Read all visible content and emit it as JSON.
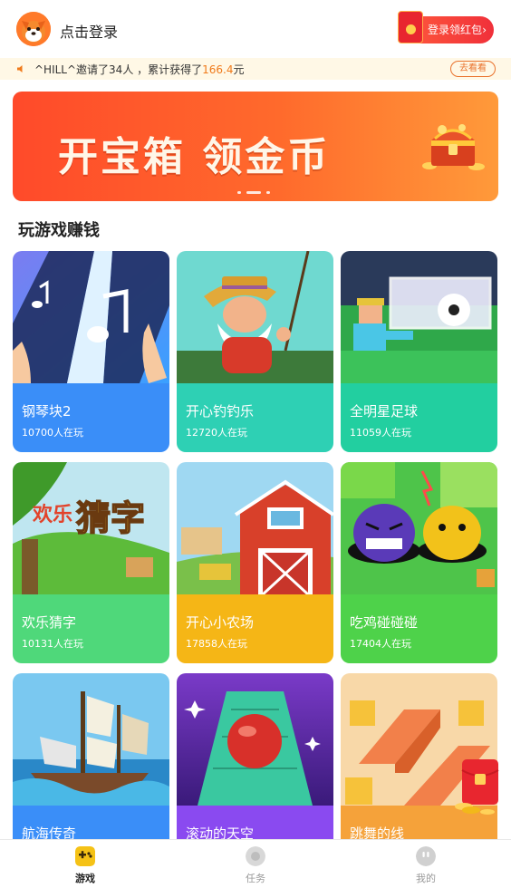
{
  "header": {
    "login_text": "点击登录",
    "redpack_label": "登录领红包",
    "redpack_chevron": "›"
  },
  "invite": {
    "text_prefix": "^HILL^邀请了34人 ，累计获得了",
    "amount": "166.4",
    "unit": "元",
    "button_label": "去看看"
  },
  "banner": {
    "text": "开宝箱 领金币",
    "slide_count": 3,
    "active_slide": 2
  },
  "section": {
    "title": "玩游戏赚钱"
  },
  "games": [
    {
      "name": "钢琴块2",
      "plays": "10700人在玩",
      "icon": "piano-tiles-art"
    },
    {
      "name": "开心钓钓乐",
      "plays": "12720人在玩",
      "icon": "fishing-art"
    },
    {
      "name": "全明星足球",
      "plays": "11059人在玩",
      "icon": "soccer-art"
    },
    {
      "name": "欢乐猜字",
      "plays": "10131人在玩",
      "icon": "word-guess-art"
    },
    {
      "name": "开心小农场",
      "plays": "17858人在玩",
      "icon": "farm-art"
    },
    {
      "name": "吃鸡碰碰碰",
      "plays": "17404人在玩",
      "icon": "bumper-art"
    },
    {
      "name": "航海传奇",
      "plays": "",
      "icon": "sailing-art"
    },
    {
      "name": "滚动的天空",
      "plays": "",
      "icon": "rolling-sky-art"
    },
    {
      "name": "跳舞的线",
      "plays": "",
      "icon": "dancing-line-art"
    }
  ],
  "tabs": [
    {
      "label": "游戏",
      "icon": "game-icon",
      "active": true
    },
    {
      "label": "任务",
      "icon": "task-icon",
      "active": false
    },
    {
      "label": "我的",
      "icon": "profile-icon",
      "active": false
    }
  ],
  "colors": {
    "accent": "#f07a1a",
    "redpack": "#f0303a",
    "banner_start": "#ff4a2a",
    "banner_end": "#ff9a3a"
  }
}
